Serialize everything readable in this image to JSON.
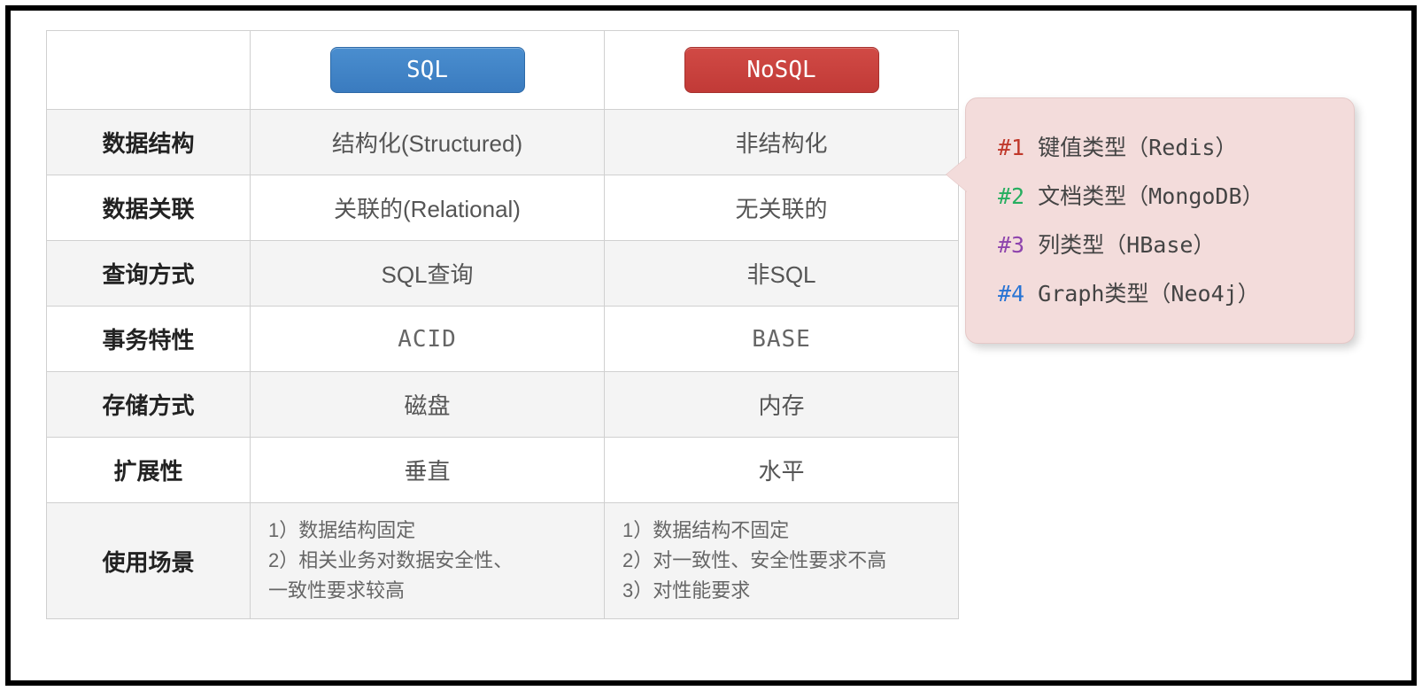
{
  "header": {
    "sql_badge": "SQL",
    "nosql_badge": "NoSQL"
  },
  "rows": [
    {
      "label": "数据结构",
      "sql": "结构化(Structured)",
      "nosql": "非结构化",
      "bold": true,
      "alt": true
    },
    {
      "label": "数据关联",
      "sql": "关联的(Relational)",
      "nosql": "无关联的",
      "alt": false
    },
    {
      "label": "查询方式",
      "sql": "SQL查询",
      "nosql": "非SQL",
      "alt": true
    },
    {
      "label": "事务特性",
      "sql": "ACID",
      "nosql": "BASE",
      "mono": true,
      "alt": false
    },
    {
      "label": "存储方式",
      "sql": "磁盘",
      "nosql": "内存",
      "alt": true
    },
    {
      "label": "扩展性",
      "sql": "垂直",
      "nosql": "水平",
      "alt": false
    }
  ],
  "last": {
    "label": "使用场景",
    "sql": "1）数据结构固定\n2）相关业务对数据安全性、\n一致性要求较高",
    "nosql": "1）数据结构不固定\n2）对一致性、安全性要求不高\n3）对性能要求"
  },
  "callout": {
    "items": [
      {
        "num": "#1",
        "text": "键值类型（Redis）"
      },
      {
        "num": "#2",
        "text": "文档类型（MongoDB）"
      },
      {
        "num": "#3",
        "text": "列类型（HBase）"
      },
      {
        "num": "#4",
        "text": "Graph类型（Neo4j）"
      }
    ]
  }
}
